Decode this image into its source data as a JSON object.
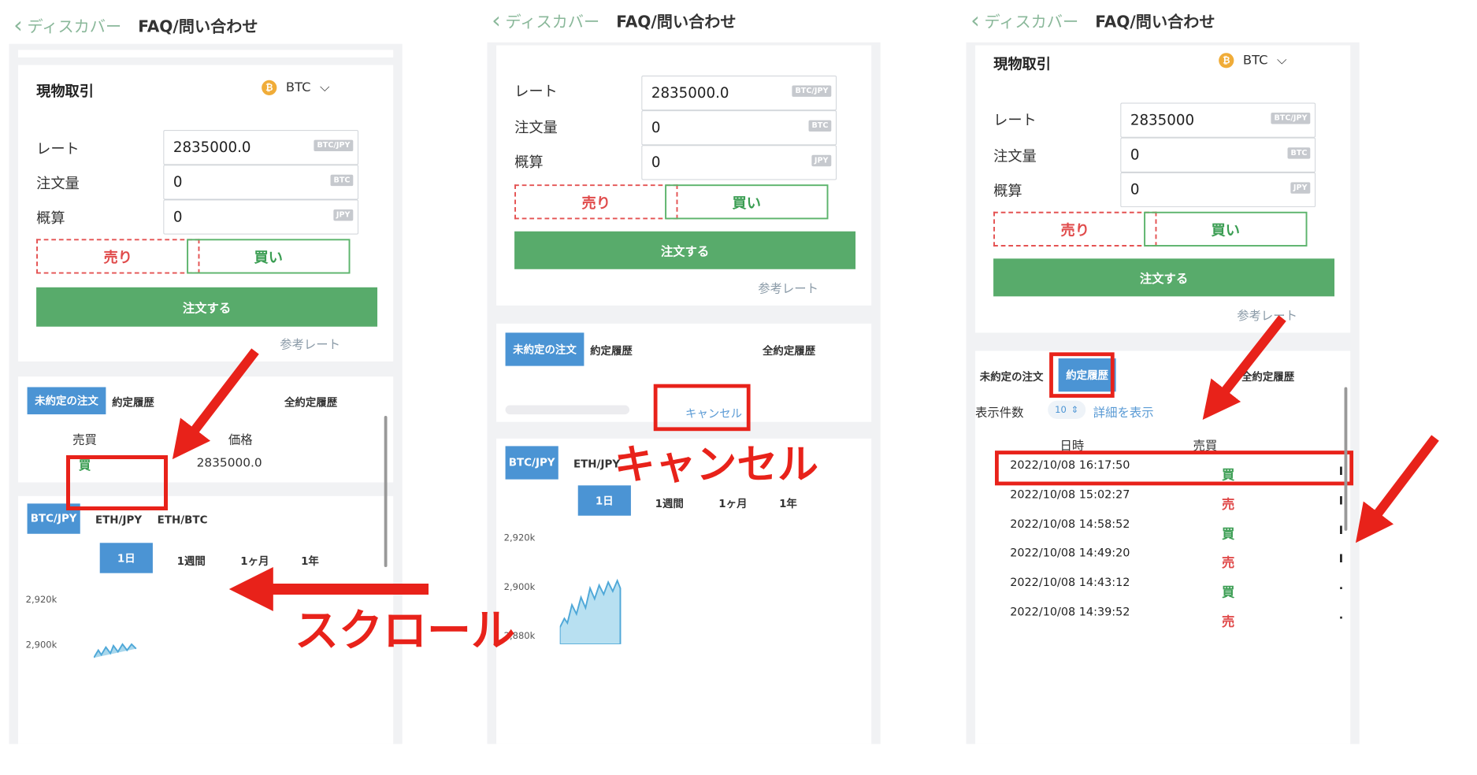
{
  "nav": {
    "back_label": "ディスカバー",
    "title": "FAQ/問い合わせ"
  },
  "trade": {
    "title": "現物取引",
    "currency": "BTC",
    "coin_icon": "₿",
    "rate_label": "レート",
    "qty_label": "注文量",
    "estimate_label": "概算",
    "rate_unit": "BTC/JPY",
    "qty_unit": "BTC",
    "estimate_unit": "JPY",
    "sell_label": "売り",
    "buy_label": "買い",
    "order_label": "注文する",
    "ref_rate_label": "参考レート"
  },
  "panels": [
    {
      "rate_value": "2835000.0",
      "qty_value": "0",
      "estimate_value": "0"
    },
    {
      "rate_value": "2835000.0",
      "qty_value": "0",
      "estimate_value": "0"
    },
    {
      "rate_value": "2835000",
      "qty_value": "0",
      "estimate_value": "0"
    }
  ],
  "orders_tabs": {
    "open": "未約定の注文",
    "history": "約定履歴",
    "all_history": "全約定履歴"
  },
  "open_orders": {
    "col_side": "売買",
    "col_price": "価格",
    "rows": [
      {
        "side": "買",
        "price": "2835000.0"
      }
    ],
    "cancel_label": "キャンセル"
  },
  "chart_tabs": {
    "pairs": [
      "BTC/JPY",
      "ETH/JPY",
      "ETH/BTC"
    ],
    "ranges": [
      "1日",
      "1週間",
      "1ヶ月",
      "1年"
    ]
  },
  "chart_axis": {
    "p1": [
      "2,920k",
      "2,900k"
    ],
    "p2": [
      "2,920k",
      "2,900k",
      "2,880k"
    ]
  },
  "history": {
    "count_label": "表示件数",
    "count_value": "10",
    "detail_label": "詳細を表示",
    "col_datetime": "日時",
    "col_side": "売買",
    "rows": [
      {
        "datetime": "2022/10/08 16:17:50",
        "side": "買"
      },
      {
        "datetime": "2022/10/08 15:02:27",
        "side": "売"
      },
      {
        "datetime": "2022/10/08 14:58:52",
        "side": "買"
      },
      {
        "datetime": "2022/10/08 14:49:20",
        "side": "売"
      },
      {
        "datetime": "2022/10/08 14:43:12",
        "side": "買"
      },
      {
        "datetime": "2022/10/08 14:39:52",
        "side": "売"
      }
    ]
  },
  "annotations": {
    "scroll": "スクロール",
    "cancel": "キャンセル"
  },
  "colors": {
    "accent": "#4b94d4",
    "green": "#58ab6b",
    "red": "#e04b4b",
    "annotation": "#e8221a"
  }
}
